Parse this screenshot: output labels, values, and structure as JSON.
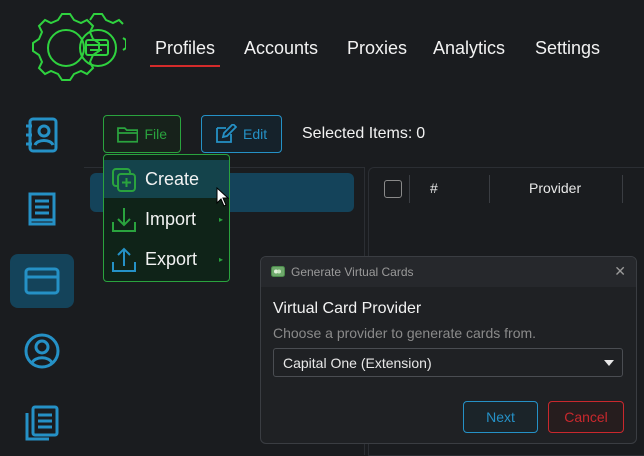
{
  "nav": {
    "items": [
      {
        "label": "Profiles",
        "active": true
      },
      {
        "label": "Accounts"
      },
      {
        "label": "Proxies"
      },
      {
        "label": "Analytics"
      },
      {
        "label": "Settings"
      }
    ]
  },
  "sidebar": {
    "items": [
      {
        "icon": "contacts-book-icon"
      },
      {
        "icon": "book-icon"
      },
      {
        "icon": "credit-card-icon",
        "active": true
      },
      {
        "icon": "user-circle-icon"
      },
      {
        "icon": "documents-icon"
      }
    ]
  },
  "toolbar": {
    "file_label": "File",
    "edit_label": "Edit",
    "selected_label": "Selected Items:",
    "selected_count": "0"
  },
  "file_menu": {
    "items": [
      {
        "label": "Create",
        "icon": "add-copy-icon"
      },
      {
        "label": "Import",
        "icon": "download-icon"
      },
      {
        "label": "Export",
        "icon": "upload-icon"
      }
    ]
  },
  "table": {
    "columns": [
      "#",
      "Provider"
    ]
  },
  "dialog": {
    "title": "Generate Virtual Cards",
    "heading": "Virtual Card Provider",
    "subtitle": "Choose a provider to generate cards from.",
    "selected_provider": "Capital One (Extension)",
    "next_label": "Next",
    "cancel_label": "Cancel"
  },
  "colors": {
    "accent_green": "#2aa33e",
    "accent_blue": "#2591c6",
    "danger": "#c9282d",
    "active_bg": "#14435a"
  }
}
